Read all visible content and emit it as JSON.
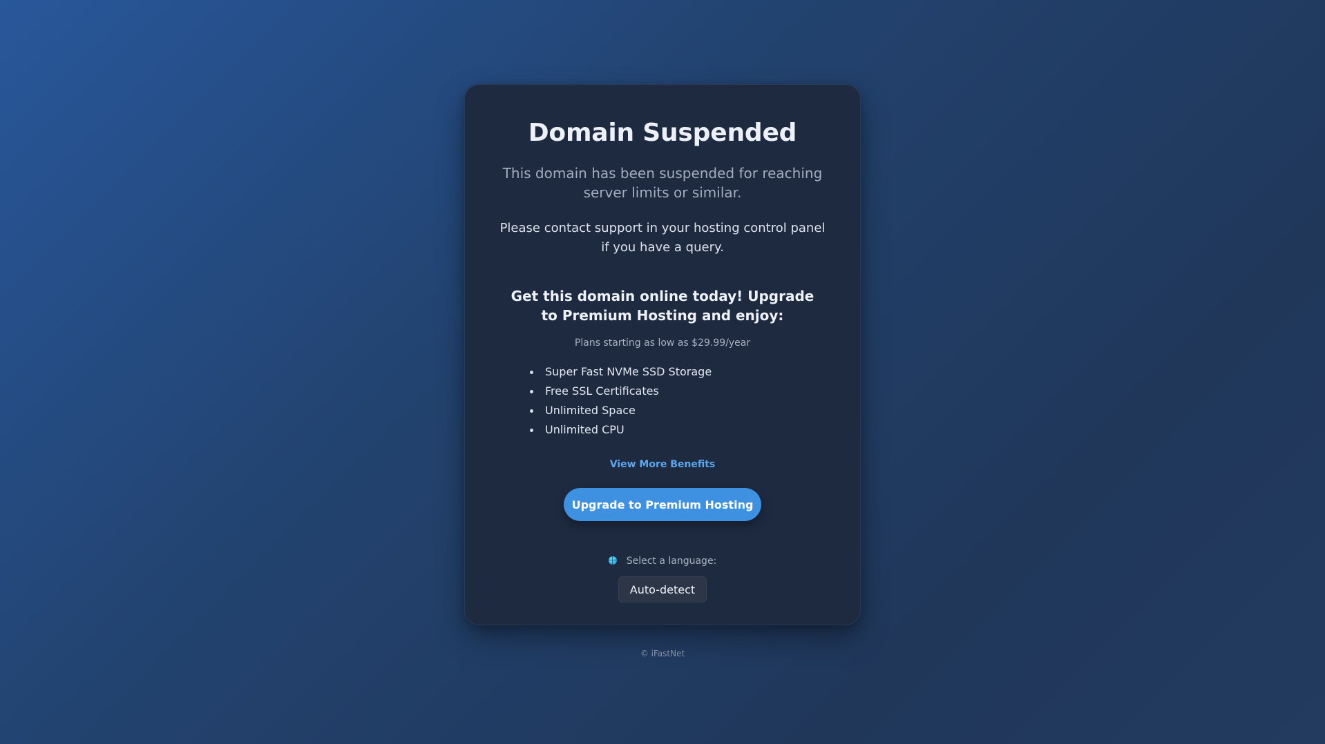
{
  "card": {
    "title": "Domain Suspended",
    "lead": "This domain has been suspended for reaching server limits or similar.",
    "contact": "Please contact support in your hosting control panel if you have a query.",
    "promo": "Get this domain online today! Upgrade to Premium Hosting and enjoy:",
    "plans": "Plans starting as low as $29.99/year",
    "benefits": [
      "Super Fast NVMe SSD Storage",
      "Free SSL Certificates",
      "Unlimited Space",
      "Unlimited CPU"
    ],
    "more_link": "View More Benefits",
    "upgrade_button": "Upgrade to Premium Hosting",
    "language": {
      "label": "Select a language:",
      "icon": "globe-icon",
      "selected": "Auto-detect"
    }
  },
  "footer": {
    "copyright": "© iFastNet"
  },
  "colors": {
    "accent": "#3d91e0",
    "link": "#5aa7ee",
    "card_bg": "#1d2a40"
  }
}
